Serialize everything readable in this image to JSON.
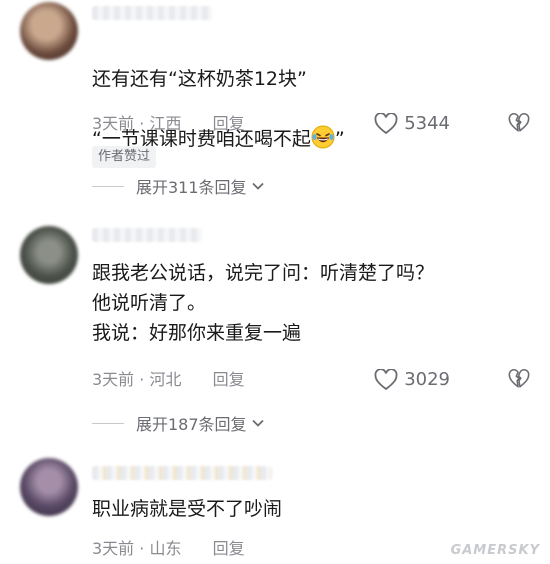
{
  "comments": [
    {
      "text_line1": "还有还有“这杯奶茶12块”",
      "text_line2": "“一节课课时费咱还喝不起",
      "text_line2_end": "”",
      "time": "3天前",
      "location": "江西",
      "reply": "回复",
      "likes": "5344",
      "badge": "作者赞过",
      "expand": "展开311条回复"
    },
    {
      "text": "跟我老公说话，说完了问：听清楚了吗？\n他说听清了。\n我说：好那你来重复一遍",
      "time": "3天前",
      "location": "河北",
      "reply": "回复",
      "likes": "3029",
      "expand": "展开187条回复"
    },
    {
      "text": "职业病就是受不了吵闹",
      "time": "3天前",
      "location": "山东",
      "reply": "回复"
    }
  ],
  "watermark": "GAMERSKY",
  "icons": {
    "like": "heart-outline-icon",
    "dislike": "broken-heart-icon",
    "expand": "chevron-down-icon",
    "emoji": "laughing-tears-emoji-icon"
  }
}
